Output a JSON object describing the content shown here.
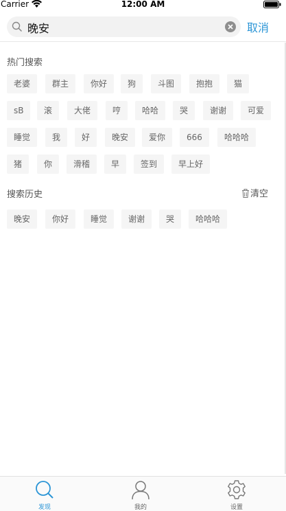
{
  "status_bar": {
    "carrier": "Carrier",
    "time": "12:00 AM"
  },
  "search": {
    "query": "晚安",
    "cancel_label": "取消"
  },
  "hot_search": {
    "title": "热门搜索",
    "rows": [
      [
        "老婆",
        "群主",
        "你好",
        "狗",
        "斗图",
        "抱抱",
        "猫"
      ],
      [
        "sB",
        "滚",
        "大佬",
        "哼",
        "哈哈",
        "哭",
        "谢谢",
        "可爱"
      ],
      [
        "睡觉",
        "我",
        "好",
        "晚安",
        "爱你",
        "666",
        "哈哈哈"
      ],
      [
        "猪",
        "你",
        "滑稽",
        "早",
        "签到",
        "早上好"
      ]
    ]
  },
  "history": {
    "title": "搜索历史",
    "clear_label": "清空",
    "items": [
      "晚安",
      "你好",
      "睡觉",
      "谢谢",
      "哭",
      "哈哈哈"
    ]
  },
  "tabbar": {
    "items": [
      {
        "label": "发现",
        "icon": "search-icon",
        "active": true
      },
      {
        "label": "我的",
        "icon": "user-icon",
        "active": false
      },
      {
        "label": "设置",
        "icon": "gear-icon",
        "active": false
      }
    ]
  },
  "colors": {
    "accent": "#2b95d6",
    "tag_bg": "#f5f5f5",
    "text_secondary": "#666666"
  }
}
